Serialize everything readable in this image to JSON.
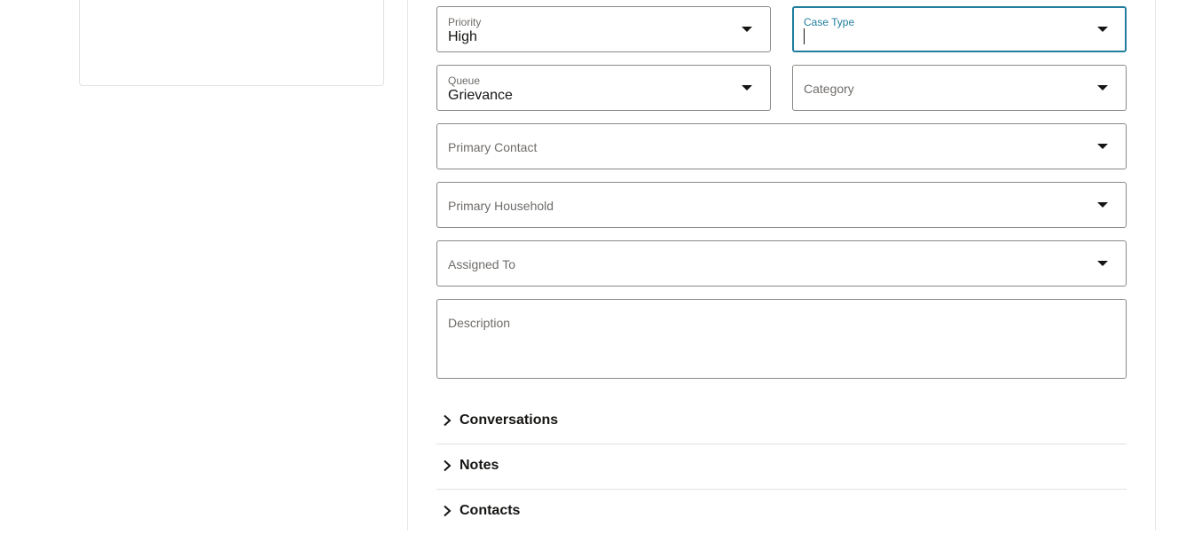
{
  "form": {
    "priority": {
      "label": "Priority",
      "value": "High"
    },
    "case_type": {
      "label": "Case Type",
      "value": ""
    },
    "queue": {
      "label": "Queue",
      "value": "Grievance"
    },
    "category": {
      "placeholder": "Category"
    },
    "primary_contact": {
      "placeholder": "Primary Contact"
    },
    "primary_household": {
      "placeholder": "Primary Household"
    },
    "assigned_to": {
      "placeholder": "Assigned To"
    },
    "description": {
      "placeholder": "Description"
    }
  },
  "sections": [
    {
      "label": "Conversations"
    },
    {
      "label": "Notes"
    },
    {
      "label": "Contacts"
    }
  ],
  "colors": {
    "focus": "#227e9e",
    "border": "#8b8985",
    "label": "#6f6c69",
    "text": "#161513"
  }
}
